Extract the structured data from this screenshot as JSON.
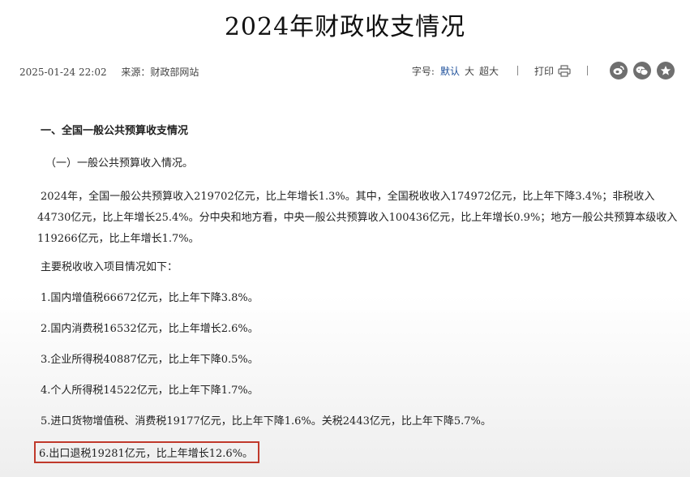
{
  "article": {
    "title": "2024年财政收支情况",
    "date": "2025-01-24 22:02",
    "source": "来源：财政部网站",
    "font_size_label": "字号:",
    "font_sizes": [
      "默认",
      "大",
      "超大"
    ],
    "print_label": "打印",
    "share_icons": [
      "weibo-icon",
      "wechat-icon",
      "favorite-icon"
    ]
  },
  "content": {
    "section_heading": "一、全国一般公共预算收支情况",
    "subheading": "（一）一般公共预算收入情况。",
    "paragraph_lines": [
      "2024年，全国一般公共预算收入219702亿元，比上年增长1.3%。其中，全国税收收入174972亿元，比上年下降3.4%；非税收入",
      "44730亿元，比上年增长25.4%。分中央和地方看，中央一般公共预算收入100436亿元，比上年增长0.9%；地方一般公共预算本级收入",
      "119266亿元，比上年增长1.7%。"
    ],
    "list_intro": "主要税收收入项目情况如下：",
    "tax_items": [
      "1.国内增值税66672亿元，比上年下降3.8%。",
      "2.国内消费税16532亿元，比上年增长2.6%。",
      "3.企业所得税40887亿元，比上年下降0.5%。",
      "4.个人所得税14522亿元，比上年下降1.7%。",
      "5.进口货物增值税、消费税19177亿元，比上年下降1.6%。关税2443亿元，比上年下降5.7%。",
      "6.出口退税19281亿元，比上年增长12.6%。"
    ]
  },
  "colors": {
    "highlight_border": "#c0392b",
    "active_font_option": "#1a4d99"
  }
}
